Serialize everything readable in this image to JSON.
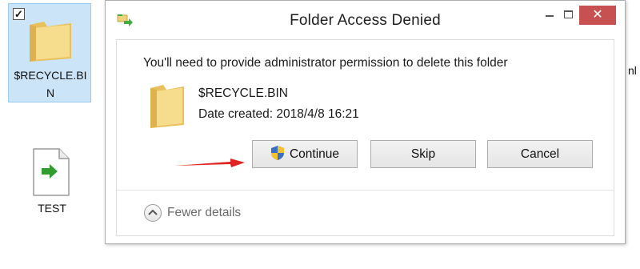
{
  "desktop": {
    "recycle_item": {
      "label": "$RECYCLE.BIN",
      "checked": true
    },
    "test_item": {
      "label": "TEST"
    },
    "edge_text": "nl"
  },
  "dialog": {
    "title": "Folder Access Denied",
    "close_glyph": "✕",
    "message": "You'll need to provide administrator permission to delete this folder",
    "item_name": "$RECYCLE.BIN",
    "item_date": "Date created: 2018/4/8 16:21",
    "buttons": {
      "continue": "Continue",
      "skip": "Skip",
      "cancel": "Cancel"
    },
    "fewer_details": "Fewer details"
  },
  "colors": {
    "selection_bg": "#cce4f7",
    "close_button": "#c75050",
    "arrow": "#e02424",
    "folder": "#f3d37a"
  },
  "icons": [
    "folder-icon",
    "file-icon",
    "checkbox-icon",
    "move-folder-icon",
    "shield-icon",
    "chevron-up-icon",
    "arrow-icon"
  ]
}
